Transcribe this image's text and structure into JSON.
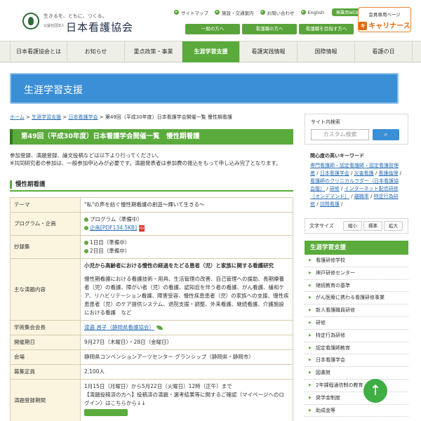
{
  "header": {
    "logo_tagline": "生きるを、ともに、つくる。",
    "logo_corp": "公益社団法人",
    "logo_name": "日本看護協会",
    "util_links": [
      "サイトマップ",
      "施設・交通案内",
      "お問い合わせ",
      "English"
    ],
    "util_pill": "無難用WEB",
    "audience_buttons": [
      "一般の方へ",
      "看護職の方へ",
      "看護職を目指す方へ"
    ],
    "member_label": "会員専用ページ",
    "member_brand": "キャリナース",
    "member_brand_icon": "キ"
  },
  "gnav": [
    "日本看護協会とは",
    "お知らせ",
    "重点政策・事業",
    "生涯学習支援",
    "看護実践情報",
    "国際情報",
    "看護の日"
  ],
  "banner": {
    "title": "生涯学習支援"
  },
  "breadcrumb": {
    "items": [
      "ホーム",
      "生涯学習支援",
      "日本看護学会"
    ],
    "current": "第49回（平成30年度）日本看護学会開催一覧 慢性期看護",
    "sep": ">"
  },
  "main": {
    "page_title": "第49回（平成30年度）日本看護学会開催一覧　慢性期看護",
    "intro_1": "参加登録、演題登録、論文投稿などは以下より行ってください。",
    "intro_2": "※共同研究者の参加は、一般参加申込みが必要です。演題発表者は参加費の振込をもって申し込み完了となります。",
    "section_title": "慢性期看護",
    "table": {
      "theme_k": "テーマ",
      "theme_v": "\"私\"の声を紡ぐ慢性期看護の創造～輝いて生きる～",
      "program_k": "プログラム・企画",
      "program_v1": "プログラム（準備中）",
      "program_v2": "企画[PDF134.5KB]",
      "pdf_label": "PDF",
      "abstract_k": "抄録集",
      "abstract_v1": "1日目（準備中）",
      "abstract_v2": "2日目（準備中）",
      "topic_k": "主な演題内容",
      "topic_head": "小児から高齢者における慢性の経過をたどる患者（児）と家族に関する看護研究",
      "topic_body": "慢性期看護における看護技術・用具、生活管理の改善、自己管理への援助、長期療養者（児）の看護、障がい者（児）の看護、認知症を伴う者の看護、がん看護、緩和ケア、リハビリテーション看護、障害受容、慢性疾患患者（児）の家族への支援、慢性疾患患者（児）のケア提供システム、退院支援・調整、外来看護、継続看護、介護施設における看護　など",
      "chair_k": "学術集会会長",
      "chair_v": "渡邉 昌子（静岡県看護協会）",
      "date_k": "開催期日",
      "date_v": "9月27日（木曜日）・28日（金曜日）",
      "venue_k": "会場",
      "venue_v": "静岡県コンベンションアーツセンター グランシップ（静岡県・静岡市）",
      "capacity_k": "募集定員",
      "capacity_v": "2,100人",
      "reg_k": "演題登録期間",
      "reg_v1": "1月15日（月曜日）から5月22日（火曜日）12時（正午）まで",
      "reg_v2": "【演題投稿済の方へ】投稿済の演題・選考結果等に関するご確認（マイページへのログイン）はこちらから↓↓"
    }
  },
  "sidebar": {
    "search_title": "サイト内検索",
    "search_placeholder": "カスタム検索",
    "search_button": "検索",
    "keywords_title": "関心度の高いキーワード",
    "keywords": [
      "専門看護師・認定看護師・認定看護管理者",
      "日本看護学会",
      "災害看護",
      "看護倫理",
      "看護師のクリニカルラダー（日本看護協会版）",
      "研修",
      "インターネット配信研修［オンデマンド］",
      "離職率",
      "特定行為研修",
      "訪問看護"
    ],
    "keyword_sep": " / ",
    "fontsize_label": "文字サイズ",
    "fontsize_buttons": [
      "縮小",
      "標準",
      "拡大"
    ],
    "nav_title": "生涯学習支援",
    "nav_items": [
      "看護研修学校",
      "神戸研修センター",
      "継続教育の基準",
      "がん医療に携わる看護研修事業",
      "新人看護職員研修",
      "研修",
      "特定行為研修",
      "認定看護師教育",
      "日本看護学会",
      "図書館",
      "2年課程通信制の教育",
      "奨学金制度",
      "助成金等"
    ]
  },
  "pagetop_label": "↑",
  "colors": {
    "accent_green": "#5aab3c",
    "banner_blue": "#3a8fd6",
    "link_blue": "#2a6fb5",
    "cta_orange": "#e06a0f"
  }
}
